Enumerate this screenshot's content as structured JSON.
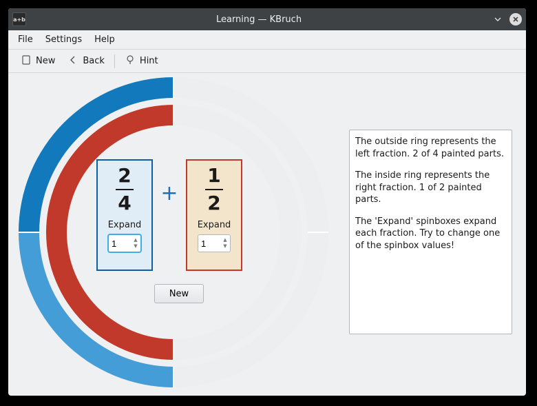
{
  "window": {
    "app_icon_text": "a+b",
    "title": "Learning — KBruch"
  },
  "menu": {
    "file": "File",
    "settings": "Settings",
    "help": "Help"
  },
  "toolbar": {
    "new": "New",
    "back": "Back",
    "hint": "Hint"
  },
  "operator": "+",
  "frac_left": {
    "numerator": "2",
    "denominator": "4",
    "label": "Expand",
    "spin_value": "1"
  },
  "frac_right": {
    "numerator": "1",
    "denominator": "2",
    "label": "Expand",
    "spin_value": "1"
  },
  "new_button": "New",
  "info": {
    "p1": "The outside ring represents the left fraction. 2 of 4 painted parts.",
    "p2": "The inside ring represents the right fraction. 1 of 2 painted parts.",
    "p3": "The 'Expand' spinboxes expand each fraction. Try to change one of the spinbox values!"
  },
  "chart_data": {
    "type": "pie",
    "title": "",
    "series": [
      {
        "name": "left-fraction",
        "ring": "outer",
        "painted": 2,
        "total": 4,
        "quarter_colors_clockwise_from_top": [
          "#eceeef",
          "#eceeef",
          "#449dd6",
          "#1179bc"
        ]
      },
      {
        "name": "right-fraction",
        "ring": "inner",
        "painted": 1,
        "total": 2,
        "half_colors_clockwise_from_top": [
          "#eceeef",
          "#c0392b"
        ]
      }
    ]
  }
}
